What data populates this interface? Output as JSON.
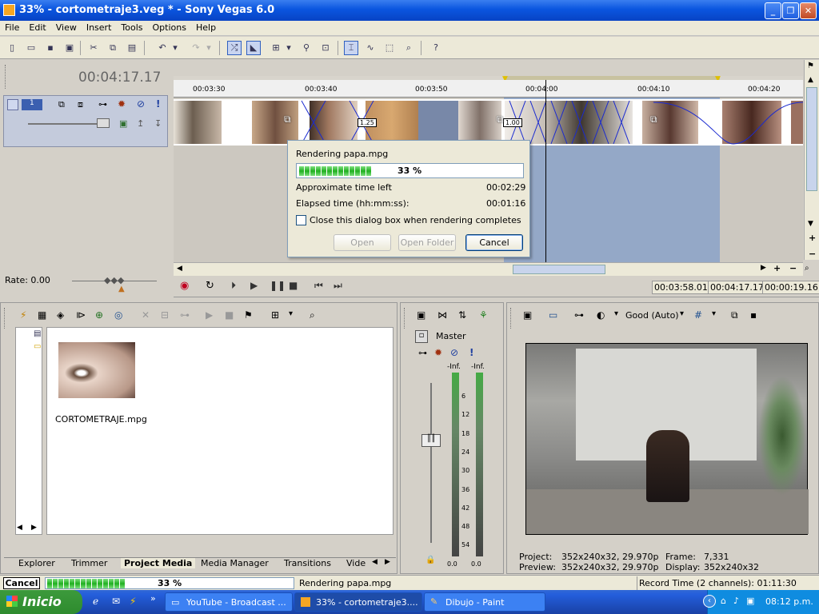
{
  "window": {
    "title": "33% - cortometraje3.veg * - Sony Vegas 6.0",
    "controls": [
      "_",
      "❐",
      "✕"
    ]
  },
  "menu": [
    "File",
    "Edit",
    "View",
    "Insert",
    "Tools",
    "Options",
    "Help"
  ],
  "timeline": {
    "timecode": "00:04:17.17",
    "track_number": "1",
    "ruler_ticks": [
      "00:03:30",
      "00:03:40",
      "00:03:50",
      "00:04:00",
      "00:04:10",
      "00:04:20"
    ],
    "event_labels": [
      "1.25",
      "1.00"
    ],
    "rate_label": "Rate: 0.00",
    "times": {
      "selection_start": "00:03:58.01",
      "selection_end": "00:04:17.17",
      "selection_length": "00:00:19.16"
    }
  },
  "render_dialog": {
    "title": "Rendering papa.mpg",
    "progress_text": "33 %",
    "progress": 0.33,
    "approx_label": "Approximate time left",
    "approx_value": "00:02:29",
    "elapsed_label": "Elapsed time (hh:mm:ss):",
    "elapsed_value": "00:01:16",
    "close_checkbox_label": "Close this dialog box when rendering completes",
    "open_button": "Open",
    "open_folder_button": "Open Folder",
    "cancel_button": "Cancel"
  },
  "project_media": {
    "file_name": "CORTOMETRAJE.mpg",
    "tabs": [
      "Explorer",
      "Trimmer",
      "Project Media",
      "Media Manager",
      "Transitions",
      "Vide"
    ],
    "active_tab": "Project Media"
  },
  "mixer": {
    "master_label": "Master",
    "peak_left": "-Inf.",
    "peak_right": "-Inf.",
    "scale": [
      "6",
      "12",
      "18",
      "24",
      "30",
      "36",
      "42",
      "48",
      "54"
    ],
    "gain_left": "0.0",
    "gain_right": "0.0"
  },
  "preview": {
    "quality": "Good (Auto)",
    "project_label": "Project:",
    "project_value": "352x240x32, 29.970p",
    "preview_label": "Preview:",
    "preview_value": "352x240x32, 29.970p",
    "frame_label": "Frame:",
    "frame_value": "7,331",
    "display_label": "Display:",
    "display_value": "352x240x32"
  },
  "status_bar": {
    "cancel": "Cancel",
    "progress_text": "33 %",
    "rendering_text": "Rendering papa.mpg",
    "record_time": "Record Time (2 channels): 01:11:30"
  },
  "taskbar": {
    "start": "Inicio",
    "items": [
      "YouTube - Broadcast ...",
      "33% - cortometraje3....",
      "Dibujo - Paint"
    ],
    "clock": "08:12 p.m."
  },
  "colors": {
    "title_bar": "#0a55df",
    "progress_green": "#20b020",
    "selection_blue": "#8ea4c8",
    "taskbar_blue": "#245edb"
  }
}
